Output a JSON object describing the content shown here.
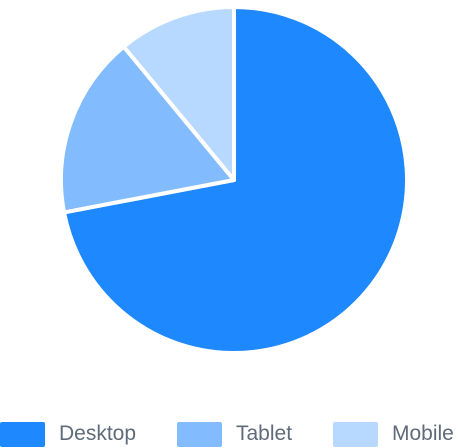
{
  "chart_data": {
    "type": "pie",
    "slices": [
      {
        "label": "Desktop",
        "value": 72,
        "color": "#1e88ff"
      },
      {
        "label": "Tablet",
        "value": 17,
        "color": "#82bcff"
      },
      {
        "label": "Mobile",
        "value": 11,
        "color": "#b8d9ff"
      }
    ],
    "legend_position": "bottom"
  }
}
